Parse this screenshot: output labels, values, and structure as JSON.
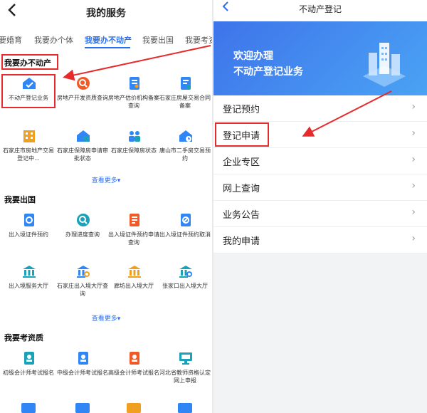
{
  "left": {
    "back_icon": "chevron-left-icon",
    "title": "我的服务",
    "tabs": [
      "要婚育",
      "我要办个体",
      "我要办不动产",
      "我要出国",
      "我要考资"
    ],
    "active_tab": 2,
    "sections": [
      {
        "title": "我要办不动产",
        "items": [
          {
            "label": "不动产登记业务",
            "icon": "house-check-icon"
          },
          {
            "label": "房地产开发资质查询",
            "icon": "search-doc-icon"
          },
          {
            "label": "房地产估价机构备案查询",
            "icon": "doc-icon"
          },
          {
            "label": "石家庄房屋交易合同备案",
            "icon": "contract-icon"
          },
          {
            "label": "石家庄市房地产交易登记中...",
            "icon": "building-icon"
          },
          {
            "label": "石家庄保障房申请审批状态",
            "icon": "house-gear-icon"
          },
          {
            "label": "石家庄保障房状态",
            "icon": "people-icon"
          },
          {
            "label": "唐山市二手房交易预约",
            "icon": "house-clock-icon"
          }
        ],
        "more": "查看更多"
      },
      {
        "title": "我要出国",
        "items": [
          {
            "label": "出入境证件预约",
            "icon": "doc-search-icon"
          },
          {
            "label": "办理进度查询",
            "icon": "search-icon"
          },
          {
            "label": "出入境证件预约申请查询",
            "icon": "doc-icon"
          },
          {
            "label": "出入境证件预约取消",
            "icon": "doc-cancel-icon"
          },
          {
            "label": "出入境服务大厅",
            "icon": "bank-icon"
          },
          {
            "label": "石家庄出入境大厅查询",
            "icon": "bank-search-icon"
          },
          {
            "label": "廊坊出入境大厅",
            "icon": "bank-icon"
          },
          {
            "label": "张家口出入境大厅",
            "icon": "bank-search-icon"
          }
        ],
        "more": "查看更多"
      },
      {
        "title": "我要考资质",
        "items": [
          {
            "label": "初级会计师考试报名",
            "icon": "doc-person-icon"
          },
          {
            "label": "中级会计师考试报名",
            "icon": "doc-person-icon"
          },
          {
            "label": "高级会计师考试报名",
            "icon": "doc-person-icon"
          },
          {
            "label": "河北省教师资格认定网上申报",
            "icon": "monitor-icon"
          }
        ]
      }
    ]
  },
  "right": {
    "back_icon": "chevron-left-icon",
    "title": "不动产登记",
    "banner": {
      "line1": "欢迎办理",
      "line2": "不动产登记业务",
      "art_icon": "city-buildings-icon"
    },
    "rows": [
      "登记预约",
      "登记申请",
      "企业专区",
      "网上查询",
      "业务公告",
      "我的申请"
    ],
    "chevron_icon": "chevron-right-icon"
  },
  "colors": {
    "accent": "#2b6ff0",
    "highlight": "#e52b2b",
    "icon_blue": "#2f86f4",
    "icon_orange": "#f0a020",
    "icon_red": "#f05a28",
    "icon_teal": "#1aa3b8"
  }
}
